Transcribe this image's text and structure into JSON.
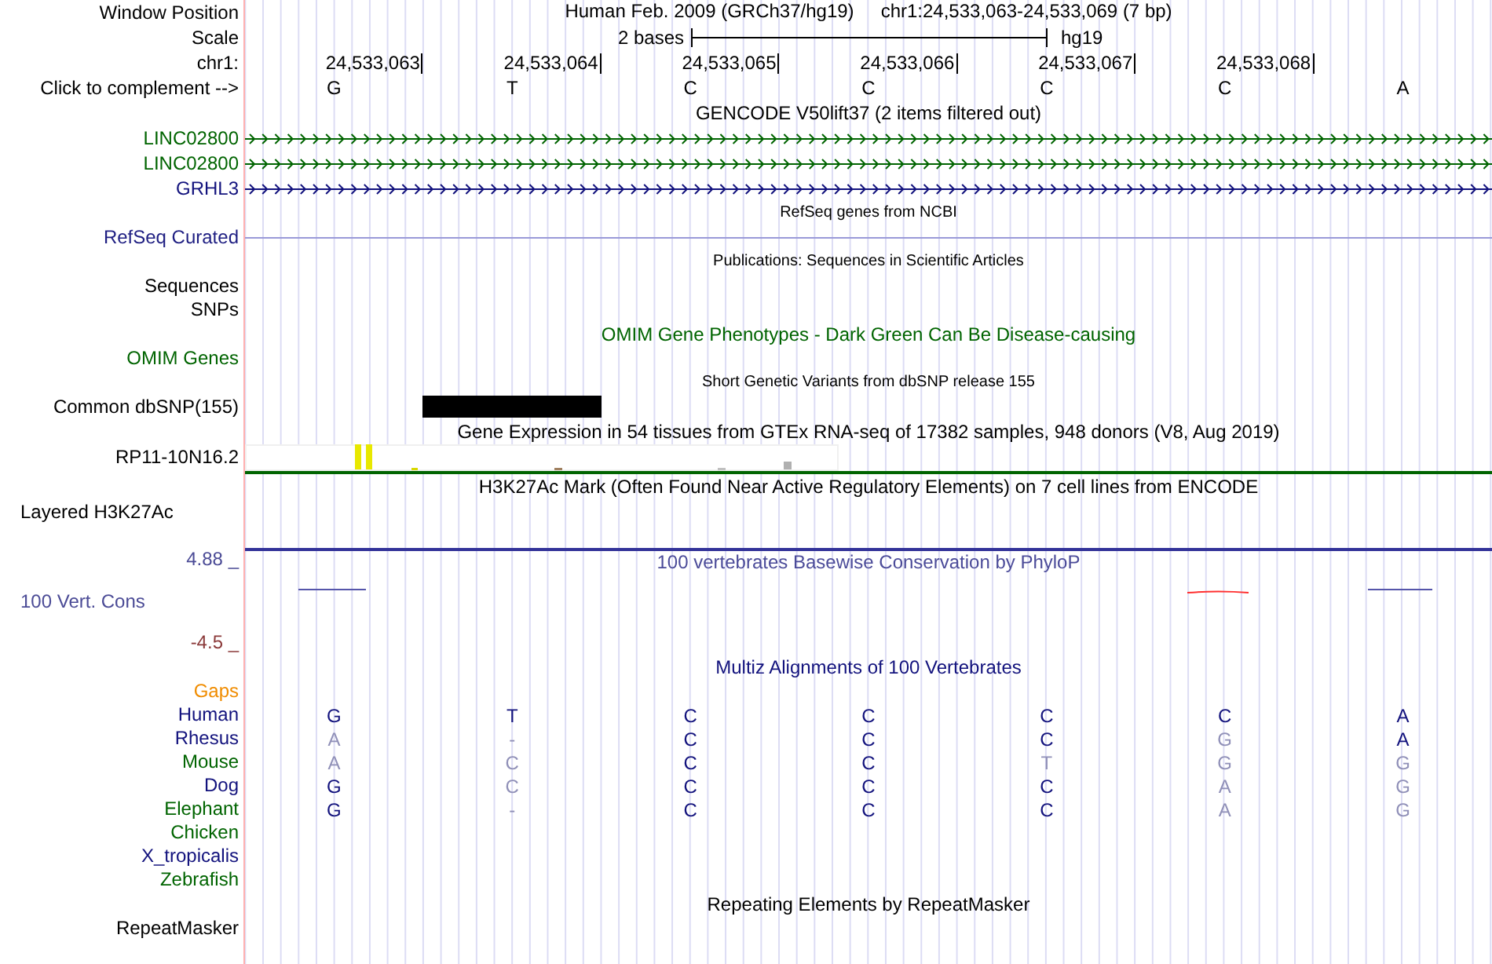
{
  "header": {
    "label": "Window Position",
    "assembly": "Human Feb. 2009 (GRCh37/hg19)",
    "position": "chr1:24,533,063-24,533,069 (7 bp)"
  },
  "scale": {
    "label": "Scale",
    "width_text": "2 bases",
    "assembly": "hg19"
  },
  "ruler": {
    "label": "chr1:",
    "positions": [
      "24,533,063",
      "24,533,064",
      "24,533,065",
      "24,533,066",
      "24,533,067",
      "24,533,068"
    ]
  },
  "sequence": {
    "label": "Click to complement -->",
    "bases": [
      "G",
      "T",
      "C",
      "C",
      "C",
      "C",
      "A"
    ]
  },
  "tracks": [
    {
      "kind": "title",
      "text": "GENCODE V50lift37 (2 items filtered out)",
      "color": "#000000",
      "small": false
    },
    {
      "kind": "gene",
      "label": "LINC02800",
      "color": "#006400"
    },
    {
      "kind": "gene",
      "label": "LINC02800",
      "color": "#006400"
    },
    {
      "kind": "gene",
      "label": "GRHL3",
      "color": "#12127d"
    },
    {
      "kind": "title",
      "text": "RefSeq genes from NCBI",
      "color": "#000000",
      "small": true
    },
    {
      "kind": "line",
      "label": "RefSeq Curated",
      "color": "#1e1e82"
    },
    {
      "kind": "title",
      "text": "Publications: Sequences in Scientific Articles",
      "color": "#000000",
      "small": true
    },
    {
      "kind": "empty",
      "label": "Sequences",
      "color": "#000000"
    },
    {
      "kind": "empty",
      "label": "SNPs",
      "color": "#000000"
    },
    {
      "kind": "title",
      "text": "OMIM Gene Phenotypes - Dark Green Can Be Disease-causing",
      "color": "#006400",
      "small": false
    },
    {
      "kind": "empty",
      "label": "OMIM Genes",
      "color": "#006400"
    },
    {
      "kind": "title",
      "text": "Short Genetic Variants from dbSNP release 155",
      "color": "#000000",
      "small": true
    },
    {
      "kind": "snp",
      "label": "Common dbSNP(155)",
      "color": "#000000"
    },
    {
      "kind": "title",
      "text": "Gene Expression in 54 tissues from GTEx RNA-seq of 17382 samples, 948 donors (V8, Aug 2019)",
      "color": "#000000",
      "small": false
    },
    {
      "kind": "expression",
      "label": "RP11-10N16.2",
      "color": "#000000"
    },
    {
      "kind": "title",
      "text": "H3K27Ac Mark (Often Found Near Active Regulatory Elements) on 7 cell lines from ENCODE",
      "color": "#000000",
      "small": false
    },
    {
      "kind": "layered",
      "label": "Layered H3K27Ac",
      "color": "#000000"
    },
    {
      "kind": "conservation",
      "label": "100 Vert. Cons",
      "color": "#4b4b96",
      "upper": "4.88 _",
      "lower": "-4.5 _",
      "title": "100 vertebrates Basewise Conservation by PhyloP"
    },
    {
      "kind": "title",
      "text": "Multiz Alignments of 100 Vertebrates",
      "color": "#12127d",
      "small": false
    },
    {
      "kind": "empty",
      "label": "Gaps",
      "color": "#f08c00"
    },
    {
      "kind": "alignment",
      "label": "Human",
      "color": "#12127d",
      "bases": [
        {
          "base": "G",
          "match": true
        },
        {
          "base": "T",
          "match": true
        },
        {
          "base": "C",
          "match": true
        },
        {
          "base": "C",
          "match": true
        },
        {
          "base": "C",
          "match": true
        },
        {
          "base": "C",
          "match": true
        },
        {
          "base": "A",
          "match": true
        }
      ]
    },
    {
      "kind": "alignment",
      "label": "Rhesus",
      "color": "#12127d",
      "bases": [
        {
          "base": "A",
          "match": false
        },
        {
          "base": "-",
          "match": false
        },
        {
          "base": "C",
          "match": true
        },
        {
          "base": "C",
          "match": true
        },
        {
          "base": "C",
          "match": true
        },
        {
          "base": "G",
          "match": false
        },
        {
          "base": "A",
          "match": true
        }
      ]
    },
    {
      "kind": "alignment",
      "label": "Mouse",
      "color": "#006400",
      "bases": [
        {
          "base": "A",
          "match": false
        },
        {
          "base": "C",
          "match": false
        },
        {
          "base": "C",
          "match": true
        },
        {
          "base": "C",
          "match": true
        },
        {
          "base": "T",
          "match": false
        },
        {
          "base": "G",
          "match": false
        },
        {
          "base": "G",
          "match": false
        }
      ]
    },
    {
      "kind": "alignment",
      "label": "Dog",
      "color": "#12127d",
      "bases": [
        {
          "base": "G",
          "match": true
        },
        {
          "base": "C",
          "match": false
        },
        {
          "base": "C",
          "match": true
        },
        {
          "base": "C",
          "match": true
        },
        {
          "base": "C",
          "match": true
        },
        {
          "base": "A",
          "match": false
        },
        {
          "base": "G",
          "match": false
        }
      ]
    },
    {
      "kind": "alignment",
      "label": "Elephant",
      "color": "#006400",
      "bases": [
        {
          "base": "G",
          "match": true
        },
        {
          "base": "-",
          "match": false
        },
        {
          "base": "C",
          "match": true
        },
        {
          "base": "C",
          "match": true
        },
        {
          "base": "C",
          "match": true
        },
        {
          "base": "A",
          "match": false
        },
        {
          "base": "G",
          "match": false
        }
      ]
    },
    {
      "kind": "empty",
      "label": "Chicken",
      "color": "#006400"
    },
    {
      "kind": "empty",
      "label": "X_tropicalis",
      "color": "#12127d"
    },
    {
      "kind": "empty",
      "label": "Zebrafish",
      "color": "#006400"
    },
    {
      "kind": "title",
      "text": "Repeating Elements by RepeatMasker",
      "color": "#000000",
      "small": false
    },
    {
      "kind": "empty",
      "label": "RepeatMasker",
      "color": "#000000"
    }
  ]
}
